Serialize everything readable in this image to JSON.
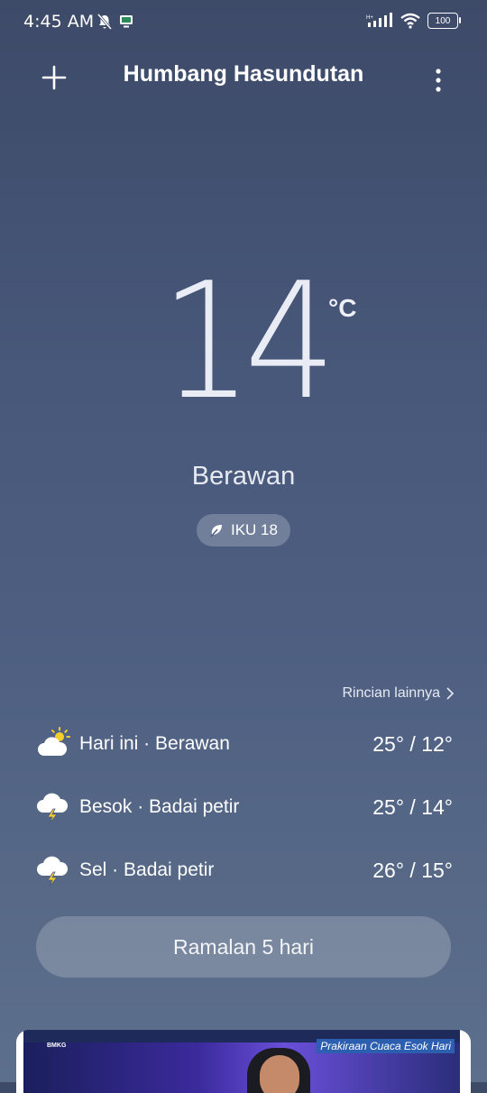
{
  "status_bar": {
    "time": "4:45 AM",
    "network_type": "H+",
    "battery": "100"
  },
  "header": {
    "city": "Humbang Hasundutan"
  },
  "current": {
    "temperature": "14",
    "unit": "°C",
    "condition": "Berawan",
    "aqi_label": "IKU 18"
  },
  "details_link": "Rincian lainnya",
  "forecast": [
    {
      "label": "Hari ini · Berawan",
      "temps": "25° / 12°",
      "icon": "partly-cloudy-icon"
    },
    {
      "label": "Besok · Badai petir",
      "temps": "25° / 14°",
      "icon": "thunderstorm-icon"
    },
    {
      "label": "Sel · Badai petir",
      "temps": "26° / 15°",
      "icon": "thunderstorm-icon"
    }
  ],
  "five_day_button": "Ramalan 5 hari",
  "video_card": {
    "brand": "BMKG",
    "title": "Prakiraan Cuaca Esok Hari"
  }
}
